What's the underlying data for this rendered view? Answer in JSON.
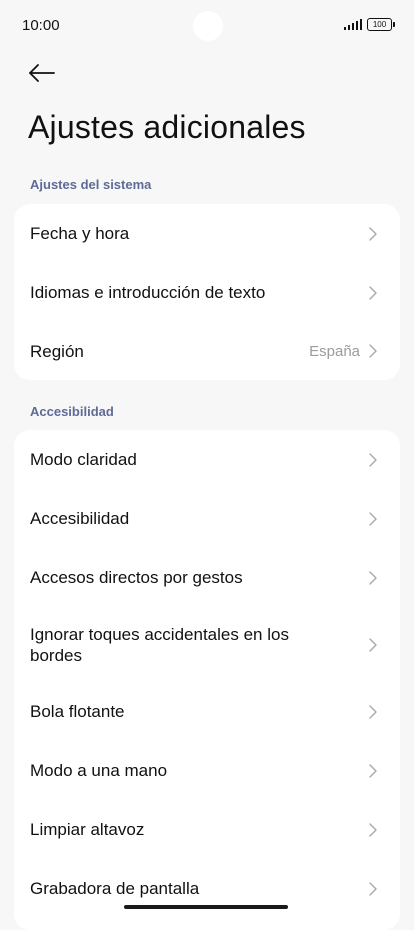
{
  "status_bar": {
    "time": "10:00",
    "battery": "100",
    "icons": [
      "signal-icon",
      "battery-icon"
    ]
  },
  "header": {
    "back_icon": "arrow-left-icon",
    "title": "Ajustes adicionales"
  },
  "sections": [
    {
      "header": "Ajustes del sistema",
      "items": [
        {
          "label": "Fecha y hora",
          "value": ""
        },
        {
          "label": "Idiomas e introducción de texto",
          "value": ""
        },
        {
          "label": "Región",
          "value": "España"
        }
      ]
    },
    {
      "header": "Accesibilidad",
      "items": [
        {
          "label": "Modo claridad",
          "value": ""
        },
        {
          "label": "Accesibilidad",
          "value": ""
        },
        {
          "label": "Accesos directos por gestos",
          "value": ""
        },
        {
          "label": "Ignorar toques accidentales en los bordes",
          "value": ""
        },
        {
          "label": "Bola flotante",
          "value": ""
        },
        {
          "label": "Modo a una mano",
          "value": ""
        },
        {
          "label": "Limpiar altavoz",
          "value": ""
        },
        {
          "label": "Grabadora de pantalla",
          "value": ""
        }
      ]
    }
  ],
  "colors": {
    "background": "#f7f7f7",
    "card": "#ffffff",
    "section_header": "#5e6b95",
    "secondary_text": "#9b9b9b"
  }
}
